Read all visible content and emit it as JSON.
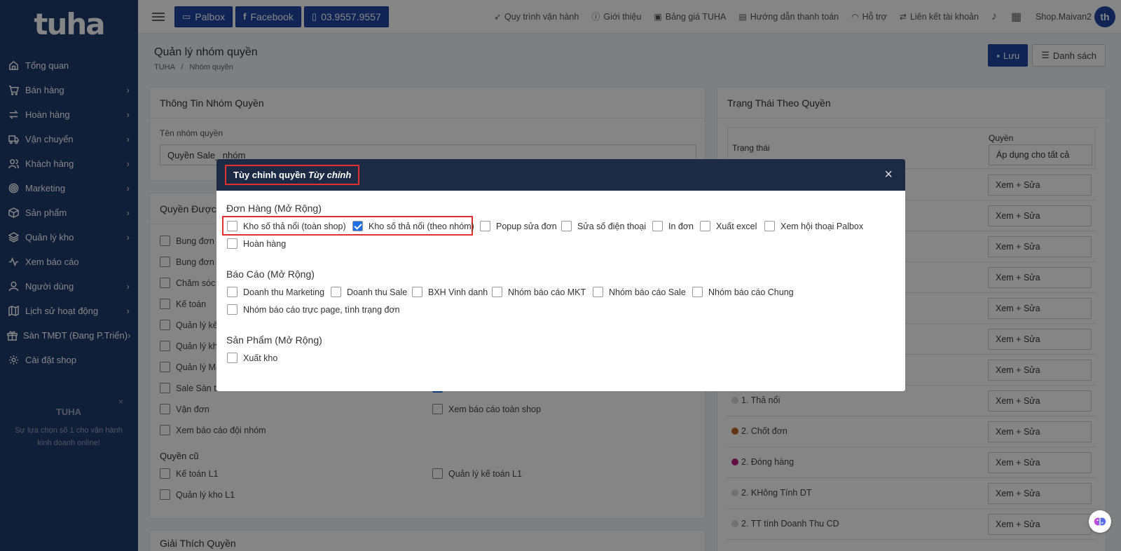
{
  "sidebar": {
    "logo": "tuha",
    "items": [
      {
        "label": "Tổng quan",
        "icon": "home-icon",
        "chevron": false
      },
      {
        "label": "Bán hàng",
        "icon": "cart-icon",
        "chevron": true
      },
      {
        "label": "Hoàn hàng",
        "icon": "return-icon",
        "chevron": true
      },
      {
        "label": "Vận chuyển",
        "icon": "truck-icon",
        "chevron": true
      },
      {
        "label": "Khách hàng",
        "icon": "users-icon",
        "chevron": true
      },
      {
        "label": "Marketing",
        "icon": "target-icon",
        "chevron": true
      },
      {
        "label": "Sản phẩm",
        "icon": "box-icon",
        "chevron": true
      },
      {
        "label": "Quản lý kho",
        "icon": "layers-icon",
        "chevron": true
      },
      {
        "label": "Xem báo cáo",
        "icon": "activity-icon",
        "chevron": false
      },
      {
        "label": "Người dùng",
        "icon": "user-icon",
        "chevron": true
      },
      {
        "label": "Lịch sử hoạt động",
        "icon": "map-icon",
        "chevron": true
      },
      {
        "label": "Sàn TMĐT (Đang P.Triển)",
        "icon": "gift-icon",
        "chevron": true
      },
      {
        "label": "Cài đặt shop",
        "icon": "gear-icon",
        "chevron": false
      }
    ],
    "promo": {
      "title": "TUHA",
      "text": "Sự lựa chọn số 1 cho vận hành kinh doanh online!",
      "close": "×"
    }
  },
  "topbar": {
    "palbox": "Palbox",
    "facebook": "Facebook",
    "phone": "03.9557.9557",
    "links": [
      "Quy trình vận hành",
      "Giới thiệu",
      "Bảng giá TUHA",
      "Hướng dẫn thanh toán",
      "Hỗ trợ",
      "Liên kết tài khoản"
    ],
    "user": "Shop.Maivan2",
    "avatar": "th"
  },
  "page": {
    "title": "Quản lý nhóm quyền",
    "crumb_root": "TUHA",
    "crumb_sep": "/",
    "crumb_current": "Nhóm quyền",
    "save": "Lưu",
    "list": "Danh sách"
  },
  "info_card": {
    "title": "Thông Tin Nhóm Quyền",
    "name_label": "Tên nhóm quyền",
    "name_value": "Quyền Sale_ nhóm"
  },
  "perm_card": {
    "title": "Quyền Được",
    "left_items": [
      "Bung đơn",
      "Bung đơn n",
      "Chăm sóc k",
      "Kế toán",
      "Quản lý kế",
      "Quản lý kha",
      "Quản lý Ma",
      "Sale Sàn th"
    ],
    "row_van_don": "Vận đơn",
    "row_xem_bao_cao_toan_shop": "Xem báo cáo toàn shop",
    "row_xem_bao_cao_doi_nhom": "Xem báo cáo đội nhóm",
    "old_title": "Quyền cũ",
    "old_items": [
      "Kế toán L1",
      "Quản lý kế toán L1",
      "Quản lý kho L1"
    ]
  },
  "explain_card": {
    "title": "Giải Thích Quyền"
  },
  "status_card": {
    "title": "Trạng Thái Theo Quyền",
    "col_status": "Trạng thái",
    "col_perm": "Quyền",
    "apply_all": "Áp dụng cho tất cả",
    "perm_value": "Xem + Sửa",
    "rows": [
      {
        "name": "",
        "color": ""
      },
      {
        "name": "",
        "color": ""
      },
      {
        "name": "",
        "color": ""
      },
      {
        "name": "",
        "color": ""
      },
      {
        "name": "",
        "color": ""
      },
      {
        "name": "",
        "color": ""
      },
      {
        "name": "",
        "color": ""
      },
      {
        "name": "1. Thả nổi",
        "color": "#d8d8d8"
      },
      {
        "name": "2. Chốt đơn",
        "color": "#c0652a"
      },
      {
        "name": "2. Đóng hàng",
        "color": "#c0208a"
      },
      {
        "name": "2. KHông Tính DT",
        "color": "#d8d8d8"
      },
      {
        "name": "2. TT tính Doanh Thu CD",
        "color": "#d8d8d8"
      }
    ]
  },
  "modal": {
    "title": "Tùy chỉnh quyền",
    "title_em": "Tùy chỉnh",
    "close": "×",
    "sections": [
      {
        "title": "Đơn Hàng (Mở Rộng)",
        "items": [
          {
            "label": "Kho số thả nổi (toàn shop)",
            "checked": false
          },
          {
            "label": "Kho số thả nổi (theo nhóm)",
            "checked": true
          },
          {
            "label": "Popup sửa đơn",
            "checked": false
          },
          {
            "label": "Sửa số điện thoại",
            "checked": false
          },
          {
            "label": "In đơn",
            "checked": false
          },
          {
            "label": "Xuất excel",
            "checked": false
          },
          {
            "label": "Xem hội thoại Palbox",
            "checked": false
          },
          {
            "label": "Hoàn hàng",
            "checked": false
          }
        ]
      },
      {
        "title": "Báo Cáo (Mở Rộng)",
        "items": [
          {
            "label": "Doanh thu Marketing",
            "checked": false
          },
          {
            "label": "Doanh thu Sale",
            "checked": false
          },
          {
            "label": "BXH Vinh danh",
            "checked": false
          },
          {
            "label": "Nhóm báo cáo MKT",
            "checked": false
          },
          {
            "label": "Nhóm báo cáo Sale",
            "checked": false
          },
          {
            "label": "Nhóm báo cáo Chung",
            "checked": false
          },
          {
            "label": "Nhóm báo cáo trực page, tình trạng đơn",
            "checked": false
          }
        ]
      },
      {
        "title": "Sản Phẩm (Mở Rộng)",
        "items": [
          {
            "label": "Xuất kho",
            "checked": false
          }
        ]
      }
    ]
  },
  "colors": {
    "sidebar": "#1e3a6e",
    "primary": "#1f46a6",
    "modal_header": "#1c2b43",
    "highlight": "#e03030",
    "checkbox_on": "#1f6fe6"
  }
}
